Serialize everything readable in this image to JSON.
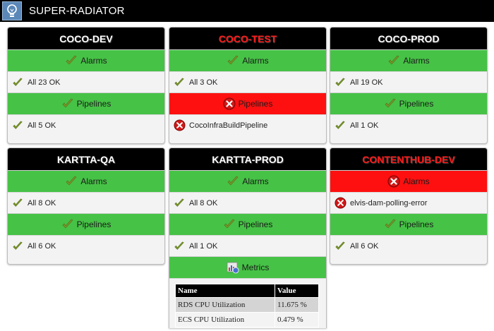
{
  "app": {
    "title": "SUPER-RADIATOR",
    "logo_icon": "lightbulb-icon"
  },
  "colors": {
    "ok_green": "#46c246",
    "alert_red": "#ff1010",
    "title_alert": "#ff1a1a"
  },
  "cards": {
    "coco_dev": {
      "title": "COCO-DEV",
      "alarms": {
        "label": "Alarms",
        "status": "All 23 OK"
      },
      "pipelines": {
        "label": "Pipelines",
        "status": "All 5 OK"
      }
    },
    "coco_test": {
      "title": "COCO-TEST",
      "alarms": {
        "label": "Alarms",
        "status": "All 3 OK"
      },
      "pipelines": {
        "label": "Pipelines",
        "status": "CocoInfraBuildPipeline"
      }
    },
    "coco_prod": {
      "title": "COCO-PROD",
      "alarms": {
        "label": "Alarms",
        "status": "All 19 OK"
      },
      "pipelines": {
        "label": "Pipelines",
        "status": "All 1 OK"
      }
    },
    "kartta_qa": {
      "title": "KARTTA-QA",
      "alarms": {
        "label": "Alarms",
        "status": "All 8 OK"
      },
      "pipelines": {
        "label": "Pipelines",
        "status": "All 6 OK"
      }
    },
    "kartta_prod": {
      "title": "KARTTA-PROD",
      "alarms": {
        "label": "Alarms",
        "status": "All 8 OK"
      },
      "pipelines": {
        "label": "Pipelines",
        "status": "All 1 OK"
      },
      "metrics": {
        "label": "Metrics",
        "headers": {
          "name": "Name",
          "value": "Value"
        },
        "rows": [
          {
            "name": "RDS CPU Utilization",
            "value": "11.675 %"
          },
          {
            "name": "ECS CPU Utilization",
            "value": "0.479 %"
          }
        ]
      }
    },
    "contenthub_dev": {
      "title": "CONTENTHUB-DEV",
      "alarms": {
        "label": "Alarms",
        "status": "elvis-dam-polling-error"
      },
      "pipelines": {
        "label": "Pipelines",
        "status": "All 6 OK"
      }
    }
  }
}
